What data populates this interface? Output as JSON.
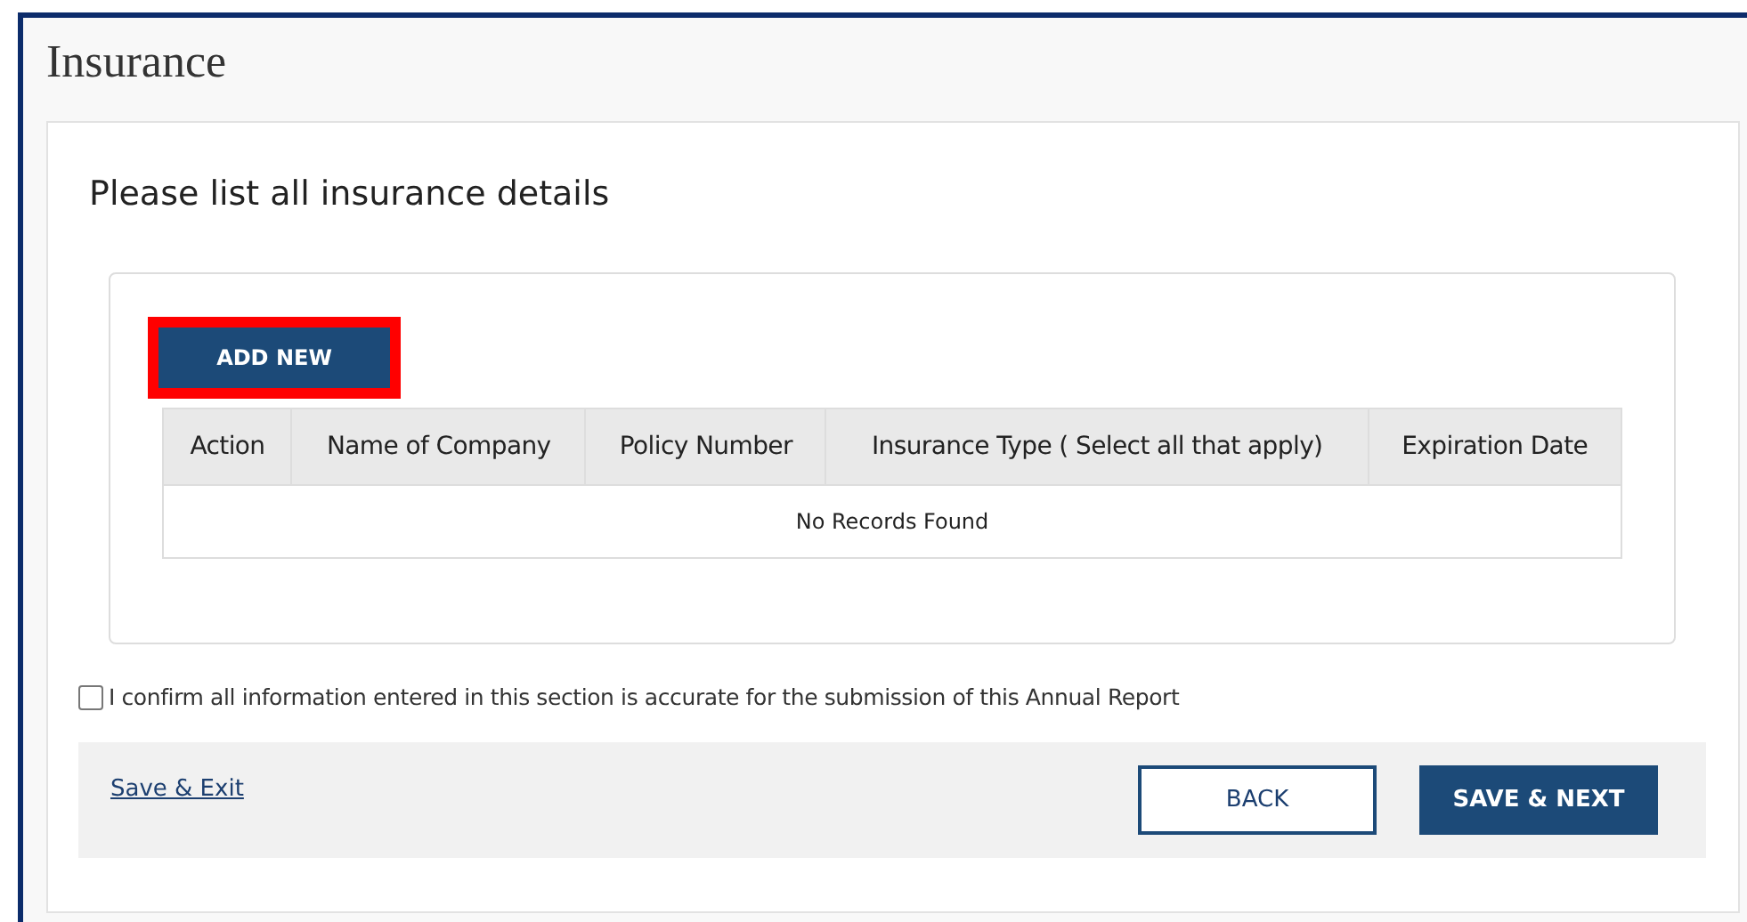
{
  "page": {
    "title": "Insurance"
  },
  "section": {
    "heading": "Please list all insurance details"
  },
  "add_button": {
    "label": "ADD NEW",
    "highlighted": true
  },
  "table": {
    "columns": [
      "Action",
      "Name of Company",
      "Policy Number",
      "Insurance Type ( Select all that apply)",
      "Expiration Date"
    ],
    "empty_message": "No Records Found"
  },
  "confirm": {
    "label": "I confirm all information entered in this section is accurate for the submission of this Annual Report",
    "checked": false
  },
  "footer": {
    "link": "Save & Exit",
    "buttons": [
      {
        "label": "BACK",
        "kind": "secondary"
      },
      {
        "label": "SAVE & NEXT",
        "kind": "primary"
      }
    ]
  }
}
